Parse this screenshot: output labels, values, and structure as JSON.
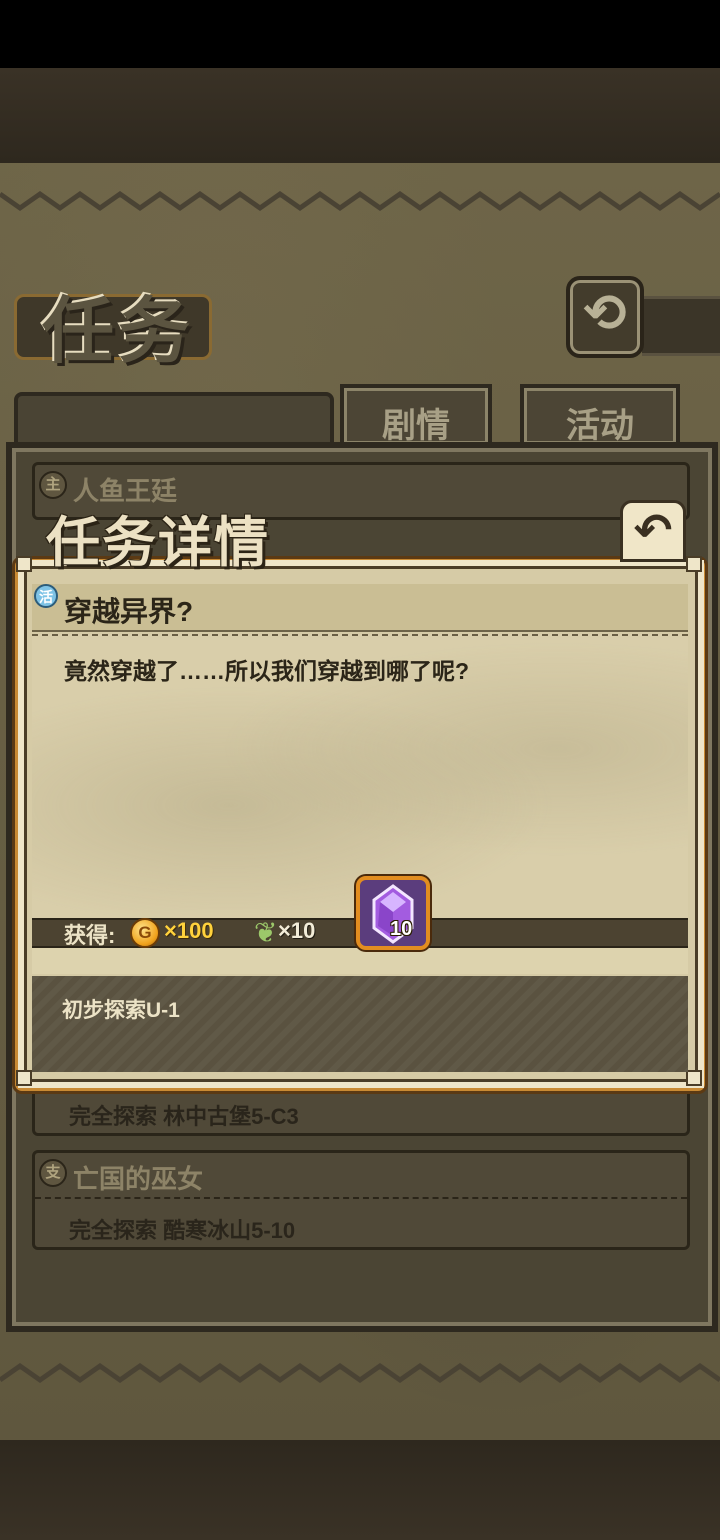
{
  "page": {
    "title": "任务",
    "back_icon": "back-arrow-icon",
    "tabs": [
      {
        "label": "剧情",
        "active": true
      },
      {
        "label": "活动",
        "active": false
      }
    ]
  },
  "list": {
    "items": [
      {
        "badge": "主",
        "title": "人鱼王廷",
        "condition": ""
      },
      {
        "badge": "",
        "title": "",
        "condition": "完全探索 林中古堡5-C3"
      },
      {
        "badge": "支",
        "title": "亡国的巫女",
        "condition": "完全探索 酷寒冰山5-10"
      }
    ]
  },
  "dialog": {
    "title": "任务详情",
    "close_icon": "back-arrow-icon",
    "badge": "活",
    "task_name": "穿越异界?",
    "description": "竟然穿越了……所以我们穿越到哪了呢?",
    "rewards": {
      "label": "获得:",
      "coin_symbol": "G",
      "coin_amount": "×100",
      "feather_amount": "×10",
      "gem_count": "10"
    },
    "condition": "初步探索U-1"
  },
  "colors": {
    "accent_orange": "#e28d20",
    "parchment": "#d9ceaa",
    "coin_gold": "#ffd23c",
    "gem_purple": "#a35ce0"
  }
}
